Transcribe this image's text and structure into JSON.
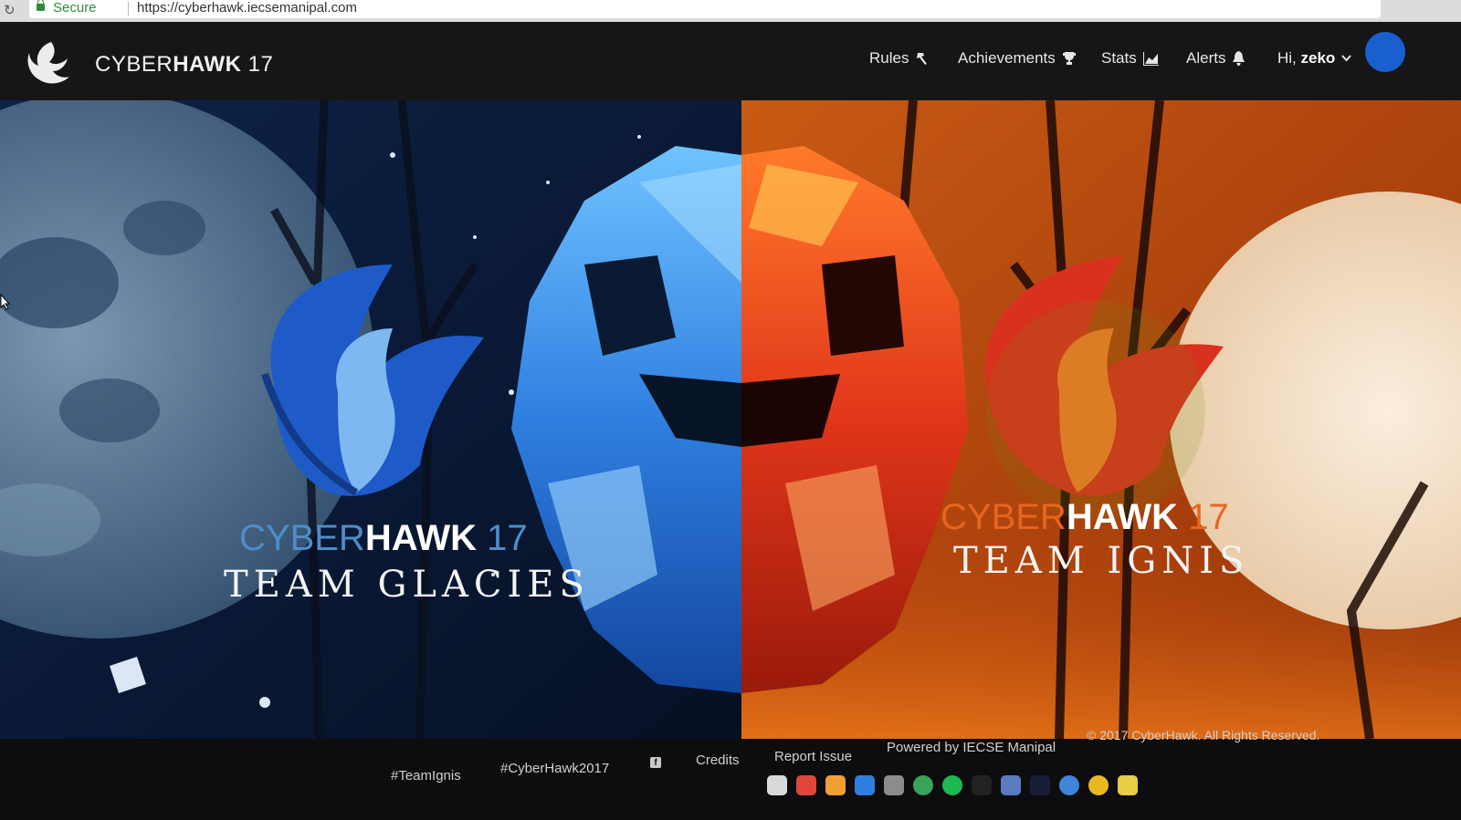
{
  "browser": {
    "secure_label": "Secure",
    "url": "https://cyberhawk.iecsemanipal.com"
  },
  "brand": {
    "light": "CYBER",
    "bold": "HAWK",
    "num": " 17"
  },
  "nav": {
    "rules": "Rules",
    "achievements": "Achievements",
    "stats": "Stats",
    "alerts": "Alerts",
    "greeting": "Hi, ",
    "username": "zeko"
  },
  "hero": {
    "left": {
      "title_light": "CYBER",
      "title_bold": "HAWK",
      "title_num": "17",
      "team": "TEAM GLACIES"
    },
    "right": {
      "title_light": "CYBER",
      "title_bold": "HAWK",
      "title_num": "17",
      "team": "TEAM IGNIS"
    }
  },
  "footer": {
    "team_tag": "#TeamIgnis",
    "event_tag": "#CyberHawk2017",
    "credits": "Credits",
    "report": "Report Issue",
    "powered": "Powered by IECSE Manipal",
    "copyright": "© 2017 CyberHawk. All Rights Reserved."
  },
  "colors": {
    "accent_blue": "#1a5fd0",
    "ice": "#4f8dc9",
    "fire": "#e0561c",
    "navbar": "#161618"
  },
  "icons": [
    "reload-icon",
    "lock-icon",
    "logo-icon",
    "hammer-icon",
    "trophy-icon",
    "chart-icon",
    "bell-icon",
    "chevron-down-icon",
    "facebook-icon"
  ]
}
